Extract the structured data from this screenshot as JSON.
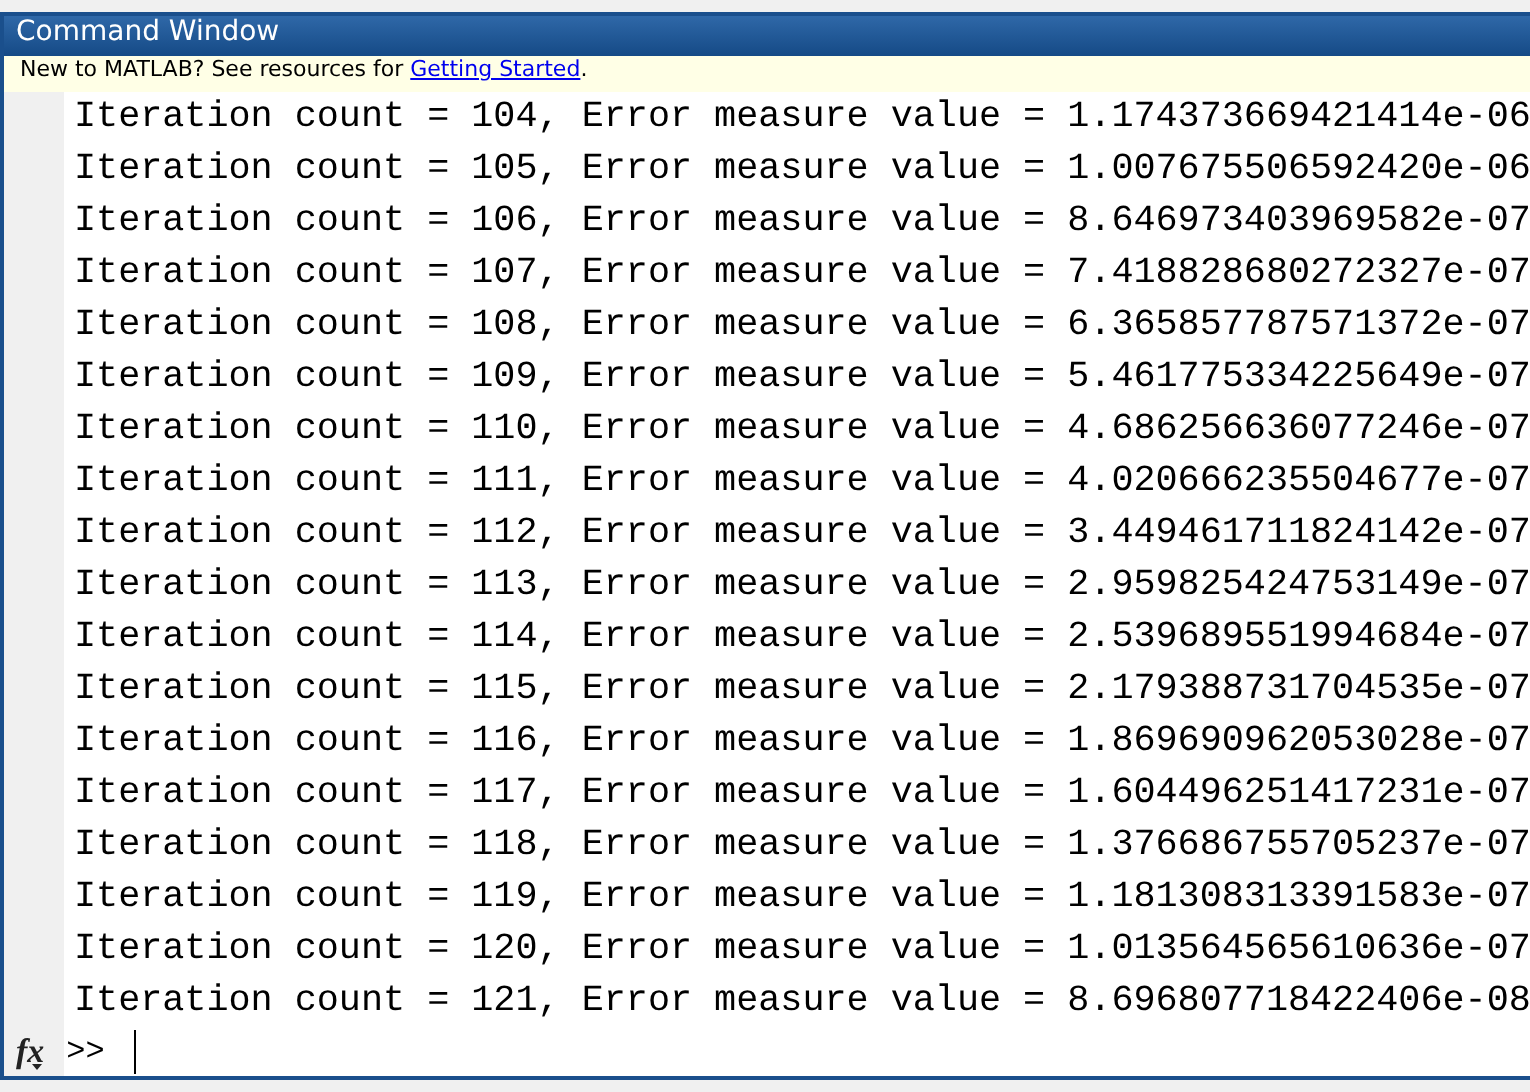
{
  "window": {
    "title": "Command Window"
  },
  "banner": {
    "text": "New to MATLAB? See resources for ",
    "link": "Getting Started",
    "after": "."
  },
  "output": [
    "Iteration count = 104, Error measure value = 1.174373669421414e-06",
    "Iteration count = 105, Error measure value = 1.007675506592420e-06",
    "Iteration count = 106, Error measure value = 8.646973403969582e-07",
    "Iteration count = 107, Error measure value = 7.418828680272327e-07",
    "Iteration count = 108, Error measure value = 6.365857787571372e-07",
    "Iteration count = 109, Error measure value = 5.461775334225649e-07",
    "Iteration count = 110, Error measure value = 4.686256636077246e-07",
    "Iteration count = 111, Error measure value = 4.020666235504677e-07",
    "Iteration count = 112, Error measure value = 3.449461711824142e-07",
    "Iteration count = 113, Error measure value = 2.959825424753149e-07",
    "Iteration count = 114, Error measure value = 2.539689551994684e-07",
    "Iteration count = 115, Error measure value = 2.179388731704535e-07",
    "Iteration count = 116, Error measure value = 1.869690962053028e-07",
    "Iteration count = 117, Error measure value = 1.604496251417231e-07",
    "Iteration count = 118, Error measure value = 1.376686755705237e-07",
    "Iteration count = 119, Error measure value = 1.181308313391583e-07",
    "Iteration count = 120, Error measure value = 1.013564565610636e-07",
    "Iteration count = 121, Error measure value = 8.696807718422406e-08"
  ],
  "prompt": {
    "function_button": "fx",
    "symbol": ">>"
  }
}
